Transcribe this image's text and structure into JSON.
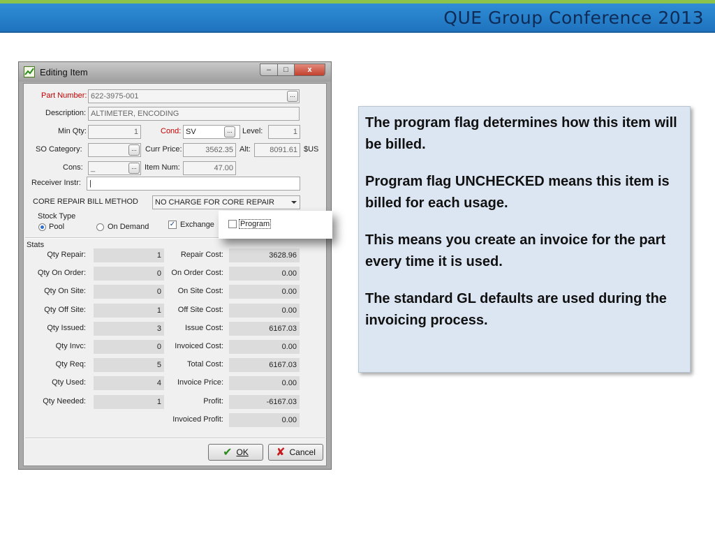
{
  "header": {
    "title": "QUE Group Conference 2013"
  },
  "colors": {
    "header_blue": "#2f8dd6",
    "accent_green": "#8cc34a",
    "note_bg": "#dce6f2",
    "required_red": "#c00000"
  },
  "window": {
    "title": "Editing Item",
    "icons": {
      "app": "chart-icon",
      "minimize": "minimize-icon",
      "maximize": "maximize-icon",
      "close": "close-icon"
    },
    "close_glyph": "x"
  },
  "form": {
    "part_number": {
      "label": "Part Number:",
      "value": "622-3975-001"
    },
    "description": {
      "label": "Description:",
      "value": "ALTIMETER, ENCODING"
    },
    "min_qty": {
      "label": "Min Qty:",
      "value": "1"
    },
    "cond": {
      "label": "Cond:",
      "value": "SV"
    },
    "level": {
      "label": "Level:",
      "value": "1"
    },
    "so_category": {
      "label": "SO Category:",
      "value": ""
    },
    "curr_price": {
      "label": "Curr Price:",
      "value": "3562.35"
    },
    "alt": {
      "label": "Alt:",
      "value": "8091.61",
      "unit": "$US"
    },
    "cons": {
      "label": "Cons:",
      "value": "_"
    },
    "item_num": {
      "label": "Item Num:",
      "value": "47.00"
    },
    "receiver_instr": {
      "label": "Receiver Instr:",
      "value": "|"
    },
    "core_repair": {
      "label": "CORE REPAIR BILL METHOD",
      "value": "NO CHARGE FOR CORE REPAIR"
    },
    "stock_type": {
      "label": "Stock Type",
      "pool": "Pool",
      "on_demand": "On Demand",
      "selected": "Pool"
    },
    "exchange": {
      "label": "Exchange",
      "checked": true
    },
    "program": {
      "label": "Program",
      "checked": false
    },
    "ellipsis": "..."
  },
  "stats": {
    "label": "Stats",
    "left": [
      {
        "label": "Qty Repair:",
        "value": "1"
      },
      {
        "label": "Qty On Order:",
        "value": "0"
      },
      {
        "label": "Qty On Site:",
        "value": "0"
      },
      {
        "label": "Qty Off Site:",
        "value": "1"
      },
      {
        "label": "Qty Issued:",
        "value": "3"
      },
      {
        "label": "Qty Invc:",
        "value": "0"
      },
      {
        "label": "Qty Req:",
        "value": "5"
      },
      {
        "label": "Qty Used:",
        "value": "4"
      },
      {
        "label": "Qty Needed:",
        "value": "1"
      }
    ],
    "right": [
      {
        "label": "Repair Cost:",
        "value": "3628.96"
      },
      {
        "label": "On Order Cost:",
        "value": "0.00"
      },
      {
        "label": "On Site Cost:",
        "value": "0.00"
      },
      {
        "label": "Off Site Cost:",
        "value": "0.00"
      },
      {
        "label": "Issue Cost:",
        "value": "6167.03"
      },
      {
        "label": "Invoiced Cost:",
        "value": "0.00"
      },
      {
        "label": "Total Cost:",
        "value": "6167.03"
      },
      {
        "label": "Invoice Price:",
        "value": "0.00"
      },
      {
        "label": "Profit:",
        "value": "-6167.03"
      },
      {
        "label": "Invoiced Profit:",
        "value": "0.00"
      }
    ]
  },
  "buttons": {
    "ok": "OK",
    "cancel": "Cancel"
  },
  "note": {
    "paragraphs": [
      "The program flag determines how this item will be billed.",
      "Program flag UNCHECKED means this item is billed for each usage.",
      "This means you create an invoice for the part every time it is used.",
      "The standard GL defaults are used during the invoicing process."
    ]
  }
}
